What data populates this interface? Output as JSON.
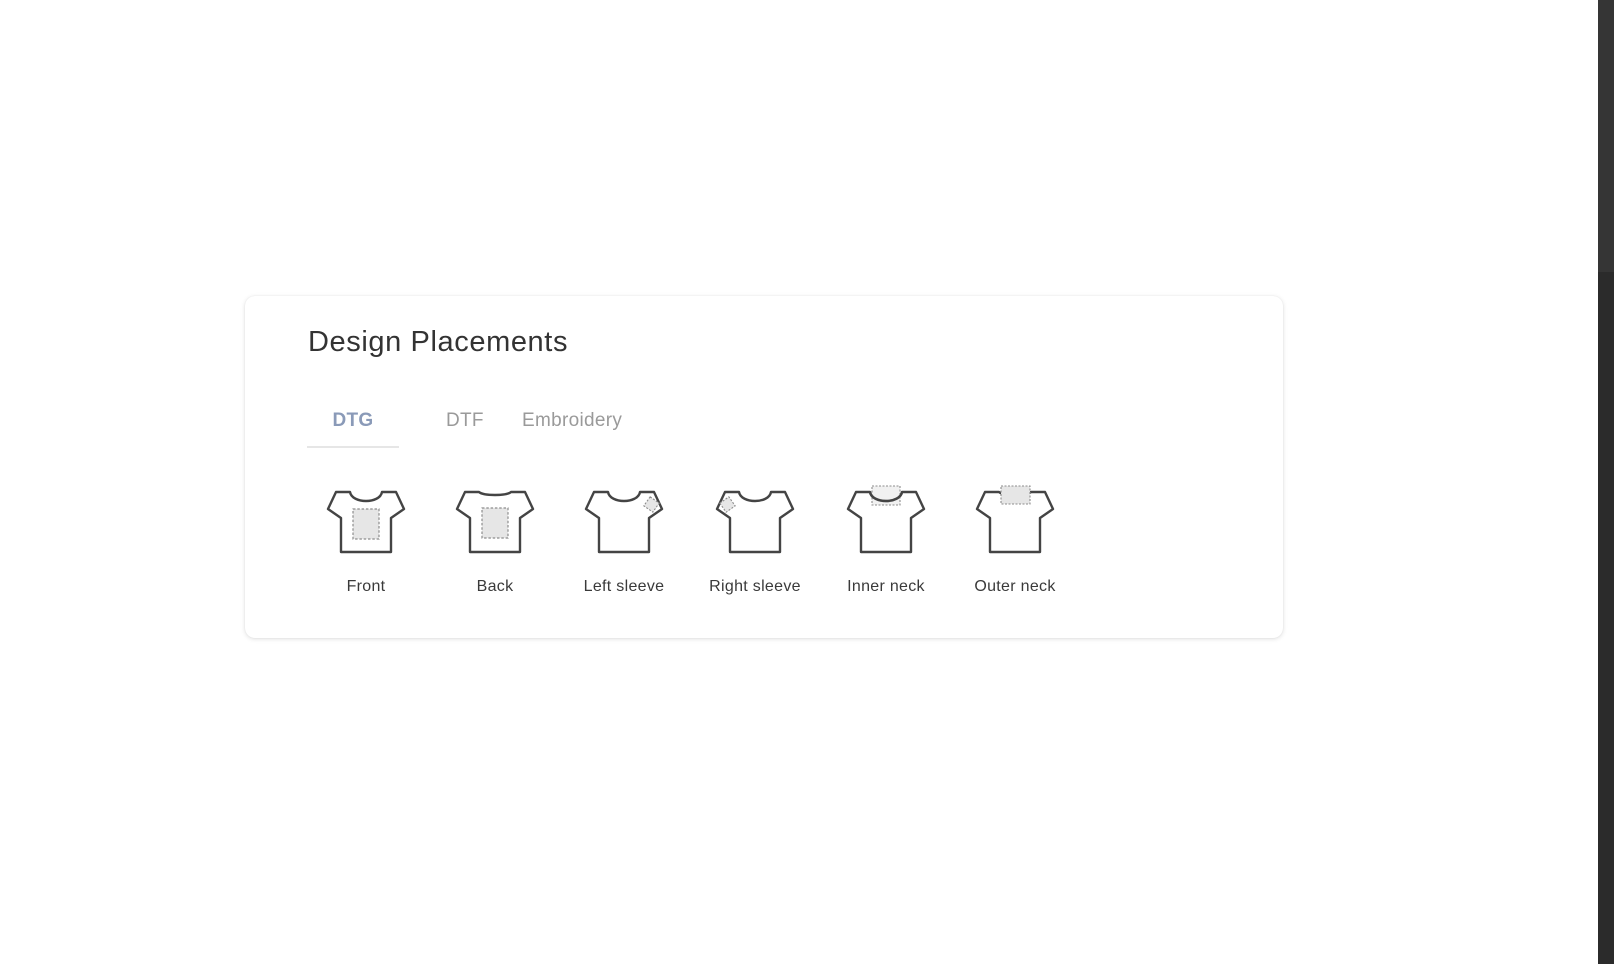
{
  "card": {
    "title": "Design Placements"
  },
  "tabs": [
    {
      "label": "DTG",
      "active": true
    },
    {
      "label": "DTF",
      "active": false
    },
    {
      "label": "Embroidery",
      "active": false
    }
  ],
  "placements": [
    {
      "label": "Front",
      "icon": "tshirt-front-icon"
    },
    {
      "label": "Back",
      "icon": "tshirt-back-icon"
    },
    {
      "label": "Left sleeve",
      "icon": "tshirt-left-sleeve-icon"
    },
    {
      "label": "Right sleeve",
      "icon": "tshirt-right-sleeve-icon"
    },
    {
      "label": "Inner neck",
      "icon": "tshirt-inner-neck-icon"
    },
    {
      "label": "Outer neck",
      "icon": "tshirt-outer-neck-icon"
    }
  ],
  "colors": {
    "active_tab": "#8a9ab8",
    "inactive_tab": "#9a9a9a",
    "outline": "#444444",
    "print_area_fill": "#e6e6e6",
    "print_area_border": "#8c8c8c"
  }
}
